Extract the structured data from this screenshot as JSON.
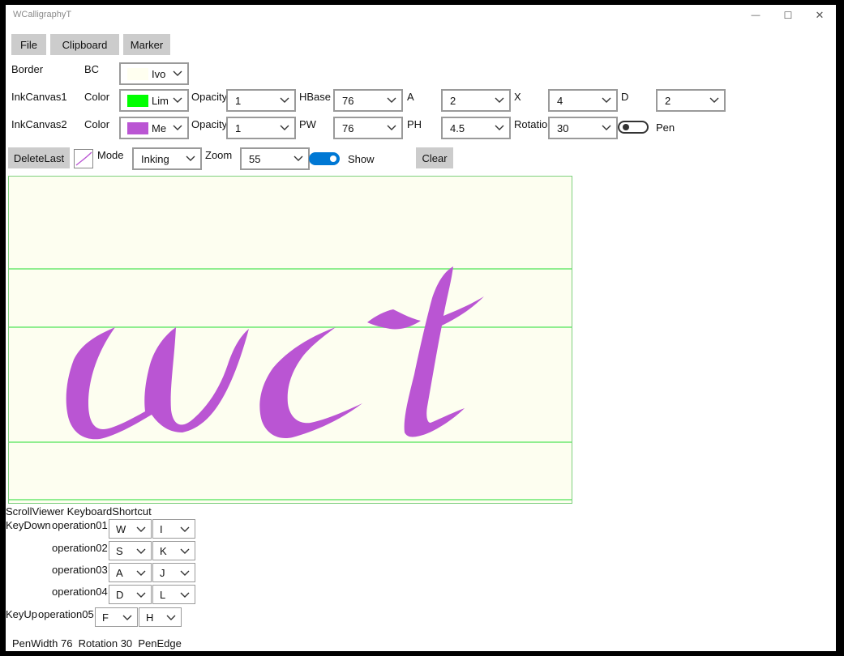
{
  "window": {
    "title": "WCalligraphyT"
  },
  "caption": {
    "minimize": "—",
    "maximize": "☐",
    "close": "✕"
  },
  "menu": {
    "file": "File",
    "clipboard": "Clipboard",
    "marker": "Marker"
  },
  "border_row": {
    "label": "Border",
    "bc_label": "BC",
    "bc_value": "Ivo",
    "bc_color": "#fffff0"
  },
  "ink1": {
    "label": "InkCanvas1",
    "color_label": "Color",
    "color_value": "Lim",
    "color_hex": "#00ff00",
    "opacity_label": "Opacity",
    "opacity_value": "1",
    "hbase_label": "HBase",
    "hbase_value": "76",
    "a_label": "A",
    "a_value": "2",
    "x_label": "X",
    "x_value": "4",
    "d_label": "D",
    "d_value": "2"
  },
  "ink2": {
    "label": "InkCanvas2",
    "color_label": "Color",
    "color_value": "Me",
    "color_hex": "#ba55d3",
    "opacity_label": "Opacity",
    "opacity_value": "1",
    "pw_label": "PW",
    "pw_value": "76",
    "ph_label": "PH",
    "ph_value": "4.5",
    "rotation_label": "Rotation",
    "rotation_value": "30",
    "pen_label": "Pen"
  },
  "toolbar": {
    "delete_last": "DeleteLast",
    "mode_label": "Mode",
    "mode_value": "Inking",
    "zoom_label": "Zoom",
    "zoom_value": "55",
    "show_label": "Show",
    "clear": "Clear"
  },
  "shortcuts": {
    "header": "ScrollViewer KeyboardShortcut",
    "keydown_label": "KeyDown",
    "keyup_label": "KeyUp",
    "rows": [
      {
        "op": "operation01",
        "k1": "W",
        "k2": "I"
      },
      {
        "op": "operation02",
        "k1": "S",
        "k2": "K"
      },
      {
        "op": "operation03",
        "k1": "A",
        "k2": "J"
      },
      {
        "op": "operation04",
        "k1": "D",
        "k2": "L"
      },
      {
        "op": "operation05",
        "k1": "F",
        "k2": "H"
      }
    ]
  },
  "status": {
    "text": "PenWidth 76  Rotation 30  PenEdge"
  },
  "colors": {
    "canvas_bg": "#fdfef0",
    "guide": "#90ee90",
    "ink": "#ba55d3",
    "accent": "#0078d4",
    "button": "#cccccc"
  }
}
